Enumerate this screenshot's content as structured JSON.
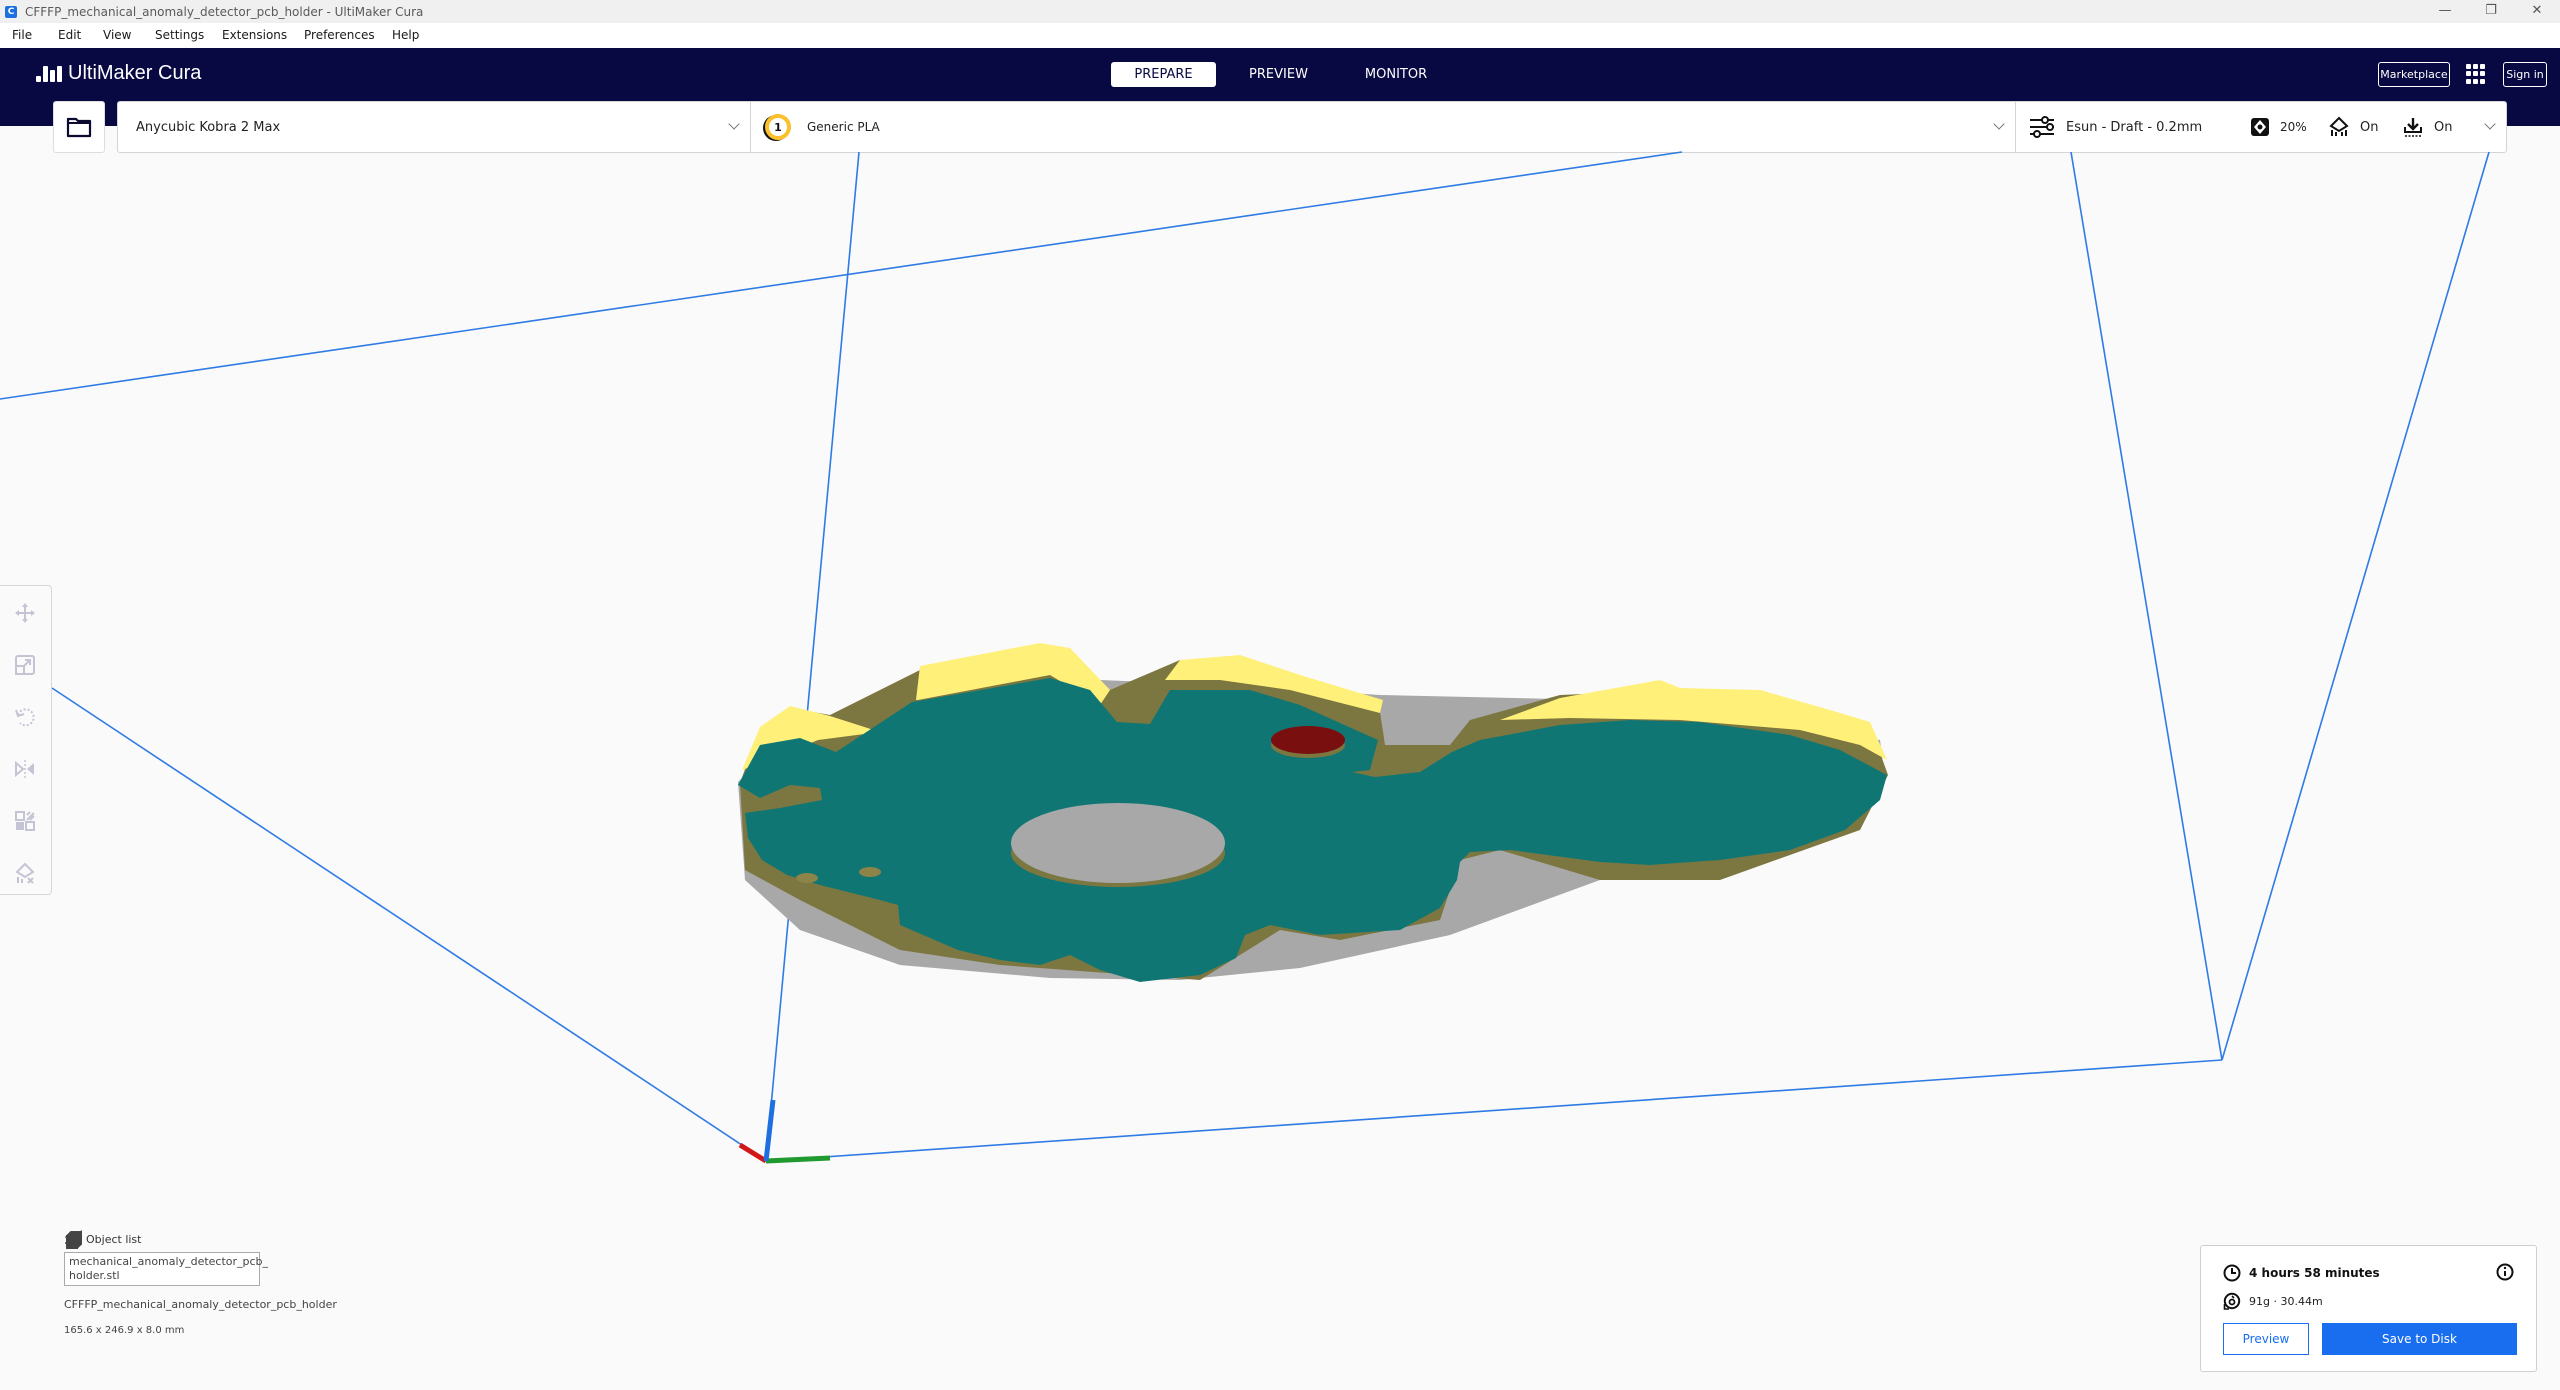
{
  "window": {
    "title": "CFFFP_mechanical_anomaly_detector_pcb_holder - UltiMaker Cura",
    "controls": [
      "minimize",
      "restore",
      "close"
    ]
  },
  "menu": {
    "items": [
      {
        "label": "File",
        "accel": "F"
      },
      {
        "label": "Edit",
        "accel": "E"
      },
      {
        "label": "View",
        "accel": "V"
      },
      {
        "label": "Settings",
        "accel": "S"
      },
      {
        "label": "Extensions",
        "accel": "x"
      },
      {
        "label": "Preferences",
        "accel": "r"
      },
      {
        "label": "Help",
        "accel": "H"
      }
    ]
  },
  "header": {
    "brand": "UltiMaker Cura",
    "tabs": [
      {
        "label": "PREPARE",
        "active": true
      },
      {
        "label": "PREVIEW",
        "active": false
      },
      {
        "label": "MONITOR",
        "active": false
      }
    ],
    "marketplace_label": "Marketplace",
    "signin_label": "Sign in"
  },
  "stage_bar": {
    "printer": "Anycubic Kobra 2 Max",
    "extruder_number": "1",
    "material": "Generic PLA",
    "profile": "Esun - Draft - 0.2mm",
    "infill": "20%",
    "support": "On",
    "adhesion": "On"
  },
  "object_list": {
    "title": "Object list",
    "file": "mechanical_anomaly_detector_pcb_holder.stl",
    "file_line1": "mechanical_anomaly_detector_pcb_",
    "file_line2": "holder.stl",
    "project_name": "CFFFP_mechanical_anomaly_detector_pcb_holder",
    "dimensions": "165.6 x 246.9 x 8.0 mm"
  },
  "job": {
    "time": "4 hours 58 minutes",
    "material_usage": "91g · 30.44m",
    "preview_label": "Preview",
    "save_label": "Save to Disk"
  },
  "colors": {
    "header_bg": "#080842",
    "accent_blue": "#196ef0",
    "model_top": "#107674",
    "model_wall": "#7c7640",
    "model_highlight": "#fff07a",
    "model_shadow": "#a8a8a8",
    "model_red": "#7a0f10",
    "build_volume_line": "#2f7be5"
  }
}
